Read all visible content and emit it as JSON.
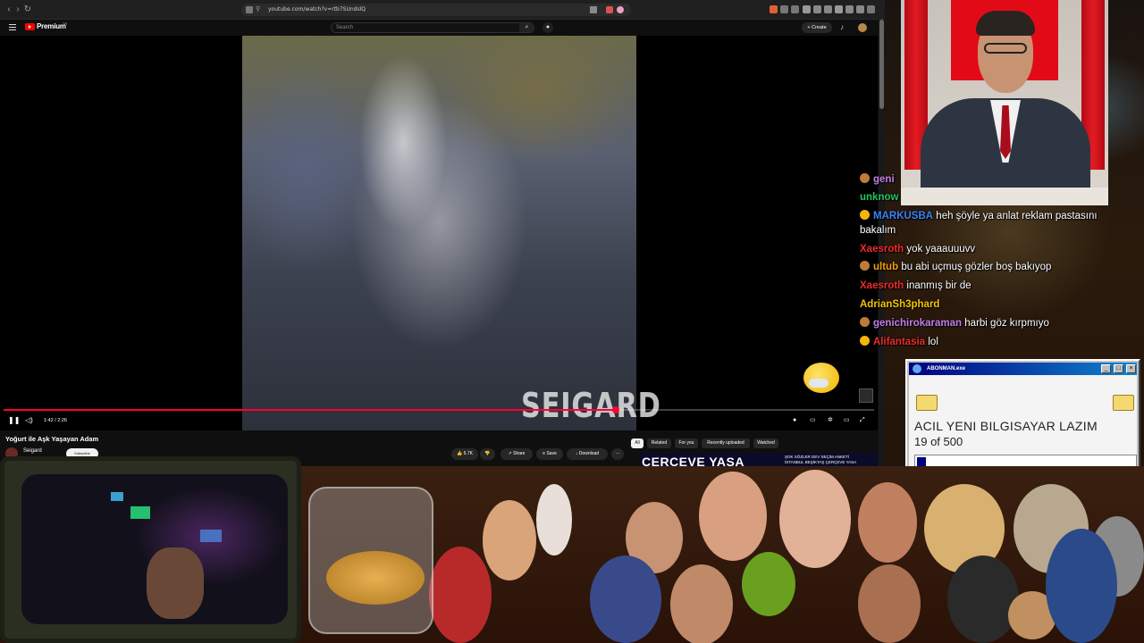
{
  "browser": {
    "url": "youtube.com/watch?v=rtb7SUndslQ",
    "colors": {
      "chrome": "#1f1f1f",
      "page": "#0f0f0f",
      "accent": "#ff0033"
    }
  },
  "youtube": {
    "brand": "Premium",
    "brand_sup": "TR",
    "search_placeholder": "Search",
    "create_label": "+ Create",
    "player": {
      "time": "1:42 / 2:26",
      "progress": 0.703,
      "watermark": "SEIGARD"
    },
    "video": {
      "title": "Yoğurt ile Aşk Yaşayan Adam",
      "channel": "Seigard",
      "subscribe_label": "Subscribe",
      "likes": "5.7K",
      "share": "Share",
      "save": "Save",
      "download": "Download",
      "more": "···"
    },
    "chips": [
      "All",
      "Related",
      "For you",
      "Recently uploaded",
      "Watched"
    ],
    "recommended_banner": {
      "headline": "ÇERÇEVE YASA",
      "caption_line1": "ŞOK SÖZLER  DEV SEÇİM ANKETİ",
      "caption_line2": "İSTANBUL BEŞİKTAŞ ÇERÇEVE YASA"
    }
  },
  "chat": [
    {
      "name": "geni",
      "message": "",
      "color": "#c27fe8",
      "badge": "#c07a3a"
    },
    {
      "name": "unknow",
      "message": "",
      "color": "#22c55e",
      "badge": ""
    },
    {
      "name": "MARKUSBA",
      "message": "heh şöyle ya anlat reklam pastasını",
      "color": "#3b82f6",
      "badge": "#f2b705"
    },
    {
      "name": "",
      "message": "bakalım",
      "color": "#ffffff",
      "badge": ""
    },
    {
      "name": "Xaesroth",
      "message": "yok yaaauuuvv",
      "color": "#ef2b2b",
      "badge": ""
    },
    {
      "name": "ultub",
      "message": "bu abi uçmuş gözler boş bakıyop",
      "color": "#f59e0b",
      "badge": "#c07a3a"
    },
    {
      "name": "Xaesroth",
      "message": "inanmış bir de",
      "color": "#ef2b2b",
      "badge": ""
    },
    {
      "name": "AdrianSh3phard",
      "message": "",
      "color": "#f5c400",
      "badge": ""
    },
    {
      "name": "genichirokaraman",
      "message": "harbi göz kırpmıyo",
      "color": "#c27fe8",
      "badge": "#c07a3a"
    },
    {
      "name": "Alifantasia",
      "message": "lol",
      "color": "#ef2b2b",
      "badge": "#f2b705"
    }
  ],
  "popup": {
    "title": "ABONMAN.exe",
    "message": "ACIL YENI BILGISAYAR LAZIM",
    "count": "19 of 500",
    "progress": 0.038,
    "min": "_",
    "max": "□",
    "close": "×"
  },
  "icons": {
    "back": "back-arrow-icon",
    "forward": "forward-arrow-icon",
    "reload": "reload-icon",
    "search": "search-icon",
    "mic": "microphone-icon",
    "bell": "bell-icon"
  }
}
